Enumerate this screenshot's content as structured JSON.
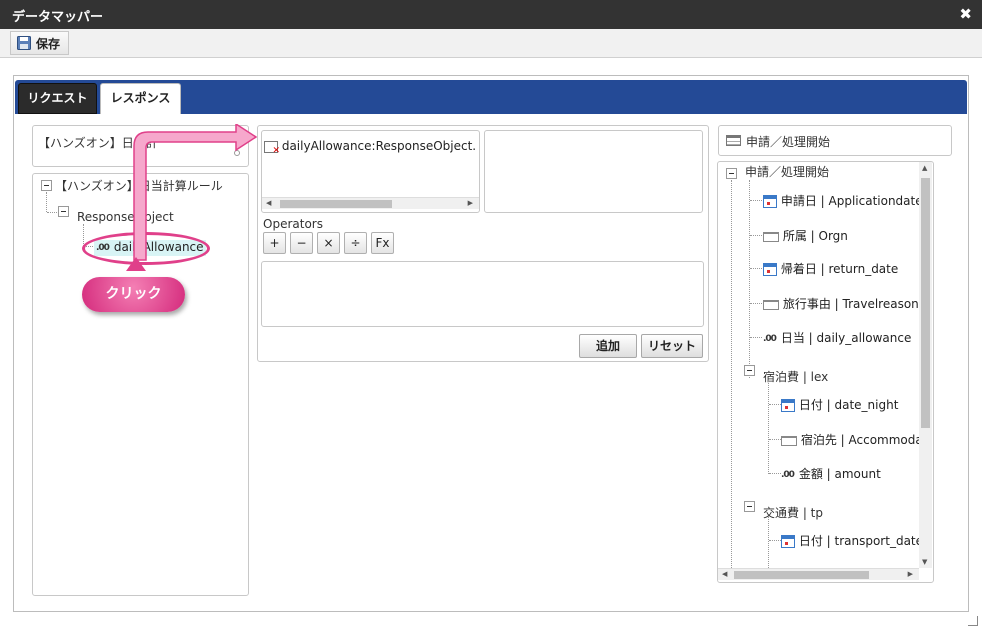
{
  "window": {
    "title": "データマッパー",
    "close_glyph": "✖"
  },
  "toolbar": {
    "save_label": "保存"
  },
  "tabs": [
    {
      "label": "リクエスト"
    },
    {
      "label": "レスポンス"
    }
  ],
  "left": {
    "source_select": "【ハンズオン】日当計",
    "tree_root": "【ハンズオン】日当計算ルール",
    "tree_child": "ResponseObject",
    "tree_leaf": "dailyAllowance",
    "leaf_icon_text": ".00"
  },
  "middle": {
    "mapping_item": "dailyAllowance:ResponseObject.【ハ】",
    "operators_label": "Operators",
    "operators": [
      "+",
      "−",
      "×",
      "÷",
      "Fx"
    ],
    "add_label": "追加",
    "reset_label": "リセット"
  },
  "right": {
    "target_select": "申請／処理開始",
    "tree_root": "申請／処理開始",
    "items": [
      {
        "label": "申請日 | Applicationdate",
        "icon": "calendar-icon"
      },
      {
        "label": "所属 | Orgn",
        "icon": "string-icon"
      },
      {
        "label": "帰着日 | return_date",
        "icon": "calendar-icon"
      },
      {
        "label": "旅行事由 | Travelreason",
        "icon": "string-icon"
      },
      {
        "label": "日当 | daily_allowance",
        "icon": "number-icon"
      }
    ],
    "group1": {
      "label": "宿泊費 | lex",
      "items": [
        {
          "label": "日付 | date_night",
          "icon": "calendar-icon"
        },
        {
          "label": "宿泊先 | Accommodati",
          "icon": "string-icon"
        },
        {
          "label": "金額 | amount",
          "icon": "number-icon"
        }
      ]
    },
    "group2": {
      "label": "交通費 | tp",
      "items": [
        {
          "label": "日付 | transport_date",
          "icon": "calendar-icon"
        }
      ]
    }
  },
  "annotation": {
    "click_label": "クリック"
  },
  "colors": {
    "tabbar": "#244a96",
    "annotation": "#e0408a",
    "titlebar": "#333333"
  }
}
